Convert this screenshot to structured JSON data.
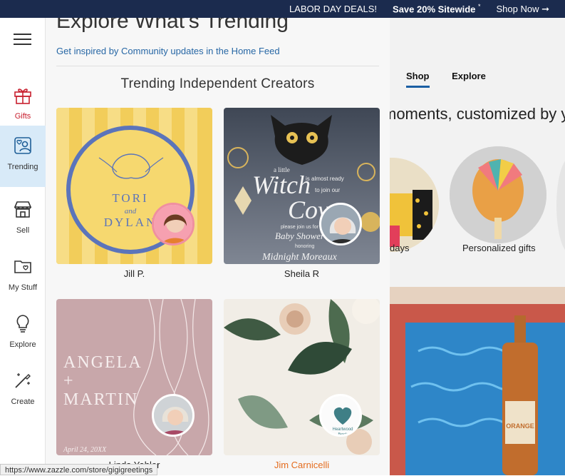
{
  "promo": {
    "deals": "LABOR DAY DEALS!",
    "save": "Save 20% Sitewide",
    "asterisk": "*",
    "cta": "Shop Now ➞"
  },
  "rail": {
    "items": [
      {
        "label": "Gifts",
        "icon": "gift-icon"
      },
      {
        "label": "Trending",
        "icon": "trending-profile-icon"
      },
      {
        "label": "Sell",
        "icon": "store-icon"
      },
      {
        "label": "My Stuff",
        "icon": "folder-heart-icon"
      },
      {
        "label": "Explore",
        "icon": "lightbulb-icon"
      },
      {
        "label": "Create",
        "icon": "magic-wand-icon"
      }
    ]
  },
  "drawer": {
    "title": "Explore What's Trending",
    "link": "Get inspired by Community updates in the Home Feed",
    "section_title": "Trending Independent Creators",
    "creators": [
      {
        "name": "Jill P."
      },
      {
        "name": "Sheila R"
      },
      {
        "name": "Linda Yahler"
      },
      {
        "name": "Jim Carnicelli"
      }
    ],
    "card_text": {
      "tori": "TORI",
      "and": "and",
      "dylan": "DYLAN",
      "a_little": "a little",
      "witch": "Witch",
      "almost_ready": "is almost ready",
      "to_join": "to join our",
      "coven": "Coven",
      "please_join": "please join us for a",
      "baby_shower": "Baby Shower",
      "honoring": "honoring",
      "midnight": "Midnight Moreaux",
      "angela": "ANGELA",
      "plus": "+",
      "martin": "MARTIN",
      "date": "April 24, 20XX",
      "heartwood": "Heartwood",
      "brook": "Brook"
    }
  },
  "background": {
    "tabs": [
      "Shop",
      "Explore"
    ],
    "headline": "moments, customized by yo",
    "category_left": "days",
    "category_right": "Personalized gifts",
    "hero_label": "ORANGE"
  },
  "status_url": "https://www.zazzle.com/store/gigigreetings",
  "colors": {
    "banner": "#1b2b4e",
    "accent_link": "#2767a5",
    "active_rail": "#d8eaf8",
    "gifts_red": "#c8202f",
    "creator_orange": "#e46c1e"
  }
}
